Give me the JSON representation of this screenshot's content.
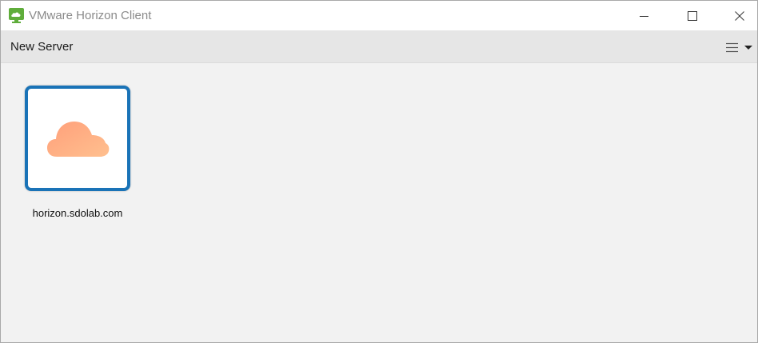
{
  "window": {
    "title": "VMware Horizon Client"
  },
  "toolbar": {
    "new_server_label": "New Server",
    "menu_icon": "hamburger-menu-icon"
  },
  "servers": [
    {
      "name": "horizon.sdolab.com",
      "icon": "cloud-icon",
      "selected": true
    }
  ],
  "colors": {
    "brand_green": "#5fad3b",
    "selection_border": "#1a73b7",
    "cloud_start": "#ff9f7a",
    "cloud_end": "#ffc08f"
  }
}
